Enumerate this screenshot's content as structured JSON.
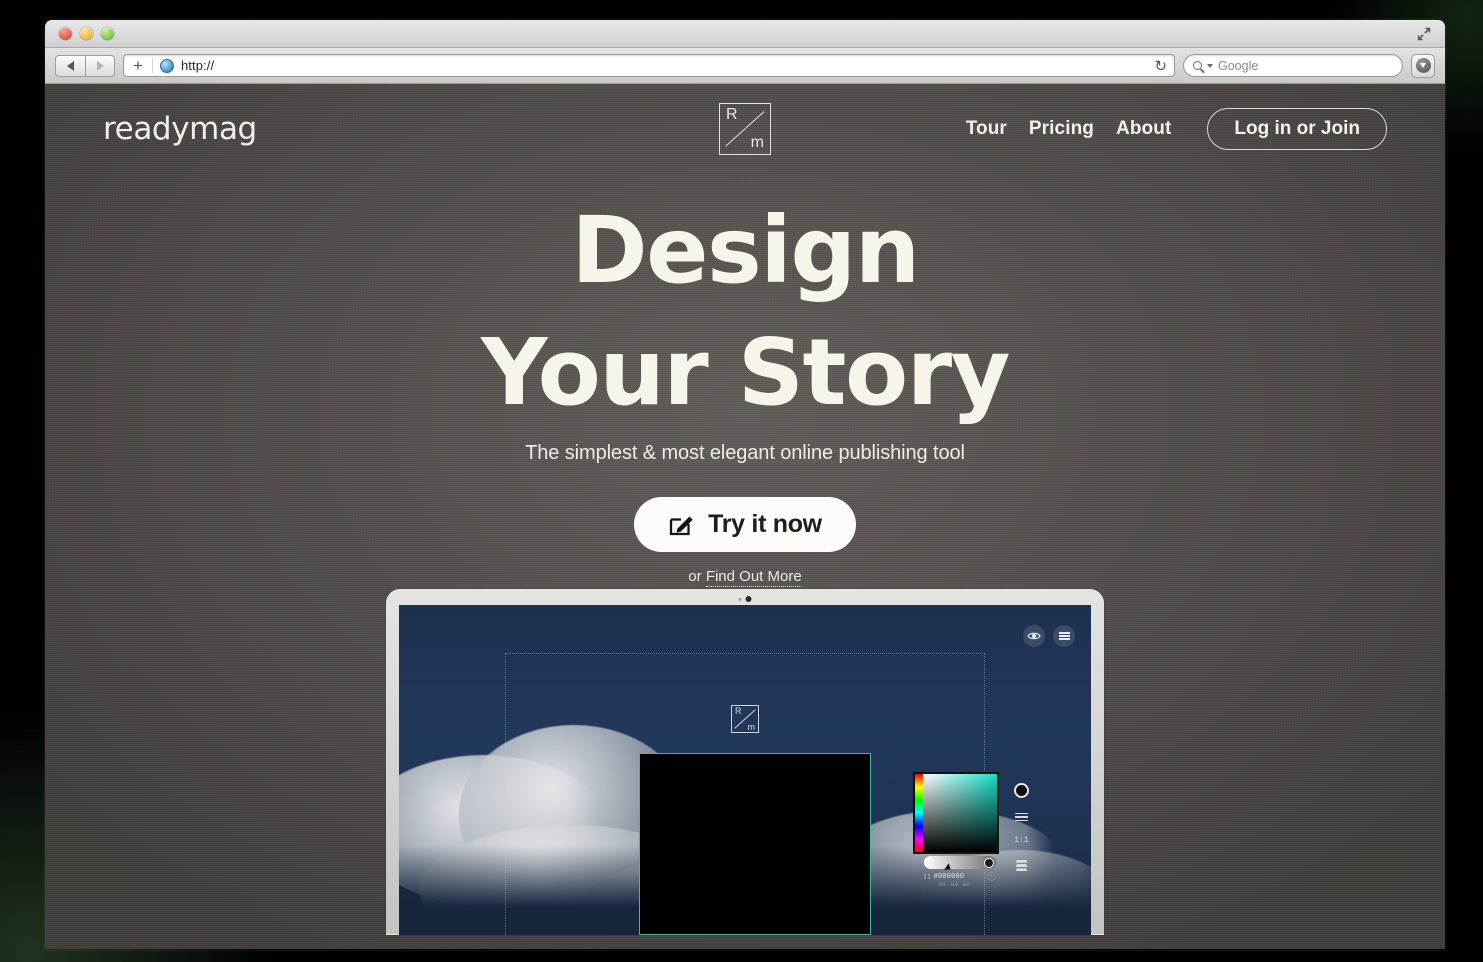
{
  "browser": {
    "traffic_lights": [
      "close",
      "minimize",
      "zoom"
    ],
    "back_label": "Back",
    "forward_label": "Forward",
    "new_tab_label": "+",
    "url": "http://",
    "url_placeholder": "http://",
    "reload_glyph": "↻",
    "search_placeholder": "Google",
    "search_value": "Google",
    "download_label": "Downloads",
    "fullscreen_label": "Full Screen"
  },
  "site": {
    "brand": "readymag",
    "logo": {
      "top_letter": "R",
      "bottom_letter": "m"
    },
    "nav": [
      {
        "label": "Tour"
      },
      {
        "label": "Pricing"
      },
      {
        "label": "About"
      }
    ],
    "login_label": "Log in or Join",
    "hero": {
      "headline_line1": "Design",
      "headline_line2": "Your Story",
      "subtitle": "The simplest & most elegant online publishing tool",
      "cta_label": "Try it now",
      "secondary_prefix": "or ",
      "secondary_link": "Find Out More"
    }
  },
  "editor_mockup": {
    "canvas_logo": {
      "top_letter": "R",
      "bottom_letter": "m"
    },
    "toolbar": [
      {
        "name": "preview-eye",
        "label": "Preview"
      },
      {
        "name": "menu",
        "label": "Menu"
      }
    ],
    "color_picker": {
      "hex": "#000000",
      "rgb": "R0 G0 B0",
      "add_label": "+"
    },
    "rail": [
      {
        "name": "color-swatch",
        "label": ""
      },
      {
        "name": "adjustments",
        "label": ""
      },
      {
        "name": "scale",
        "label": "1:1"
      },
      {
        "name": "layers",
        "label": ""
      }
    ]
  },
  "colors": {
    "page_bg": "#514c49",
    "hero_text": "#f7f4ea",
    "cta_bg": "#fdfcf8",
    "selection": "#3fb9a2",
    "screen_sky": "#1d3050"
  }
}
